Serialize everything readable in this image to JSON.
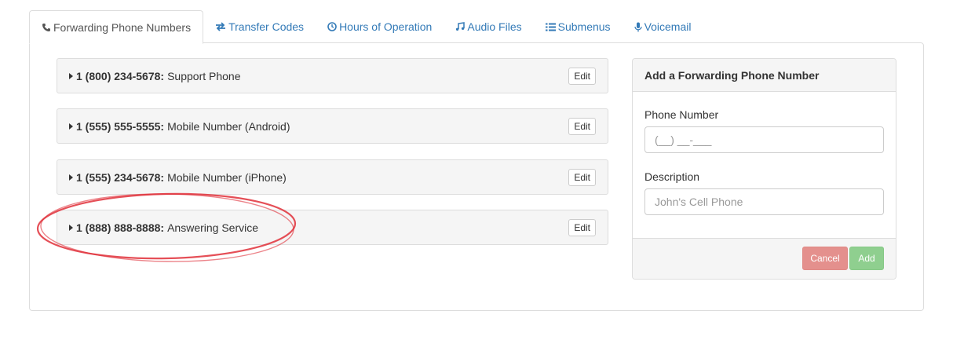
{
  "tabs": [
    {
      "label": "Forwarding Phone Numbers",
      "icon": "phone-icon",
      "active": true
    },
    {
      "label": "Transfer Codes",
      "icon": "exchange-icon",
      "active": false
    },
    {
      "label": "Hours of Operation",
      "icon": "clock-icon",
      "active": false
    },
    {
      "label": "Audio Files",
      "icon": "music-icon",
      "active": false
    },
    {
      "label": "Submenus",
      "icon": "list-icon",
      "active": false
    },
    {
      "label": "Voicemail",
      "icon": "microphone-icon",
      "active": false
    }
  ],
  "numbers": [
    {
      "number": "1 (800) 234-5678",
      "separator": ":",
      "description": "Support Phone",
      "edit_label": "Edit"
    },
    {
      "number": "1 (555) 555-5555",
      "separator": ":",
      "description": "Mobile Number (Android)",
      "edit_label": "Edit"
    },
    {
      "number": "1 (555) 234-5678",
      "separator": ":",
      "description": "Mobile Number (iPhone)",
      "edit_label": "Edit"
    },
    {
      "number": "1 (888) 888-8888",
      "separator": ":",
      "description": "Answering Service",
      "edit_label": "Edit"
    }
  ],
  "add_form": {
    "title": "Add a Forwarding Phone Number",
    "phone_label": "Phone Number",
    "phone_placeholder": "(__) __-___",
    "description_label": "Description",
    "description_placeholder": "John's Cell Phone",
    "cancel_label": "Cancel",
    "add_label": "Add"
  },
  "colors": {
    "link": "#337ab7",
    "annotation": "#e0303a",
    "cancel": "#e4908d",
    "add": "#8fcf8f"
  }
}
